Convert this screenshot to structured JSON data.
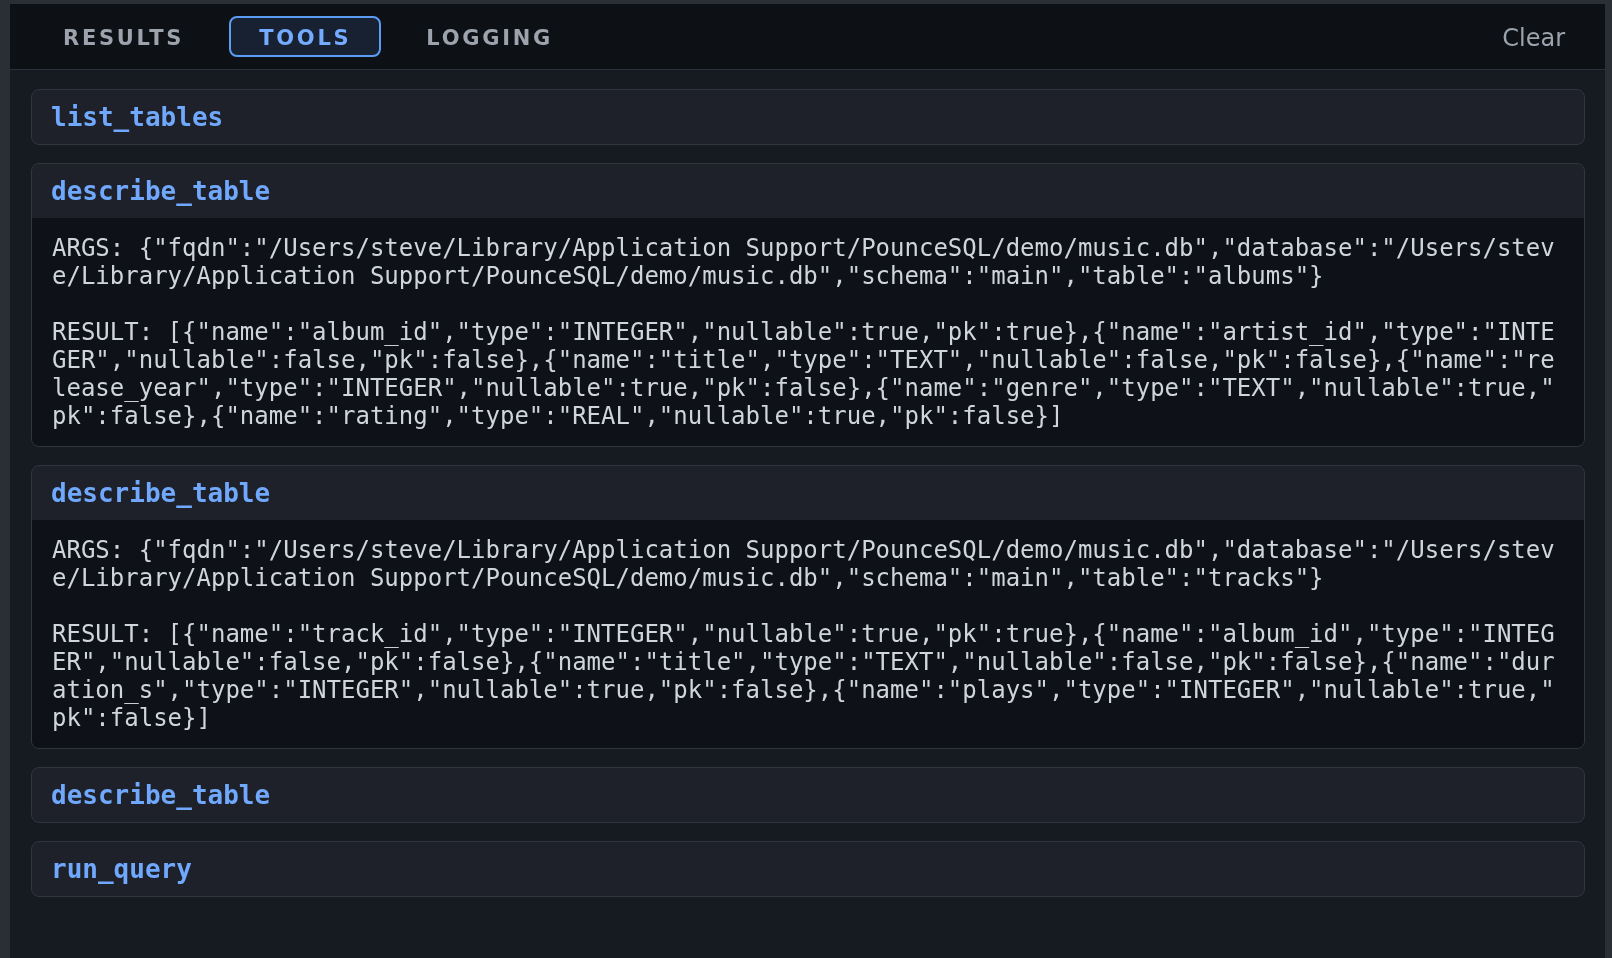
{
  "tabs": [
    {
      "label": "RESULTS",
      "selected": false
    },
    {
      "label": "TOOLS",
      "selected": true
    },
    {
      "label": "LOGGING",
      "selected": false
    }
  ],
  "clear_button": "Clear",
  "tool_calls": [
    {
      "name": "list_tables",
      "expanded": false
    },
    {
      "name": "describe_table",
      "expanded": true,
      "args": "ARGS: {\"fqdn\":\"/Users/steve/Library/Application Support/PounceSQL/demo/music.db\",\"database\":\"/Users/steve/Library/Application Support/PounceSQL/demo/music.db\",\"schema\":\"main\",\"table\":\"albums\"}",
      "result": "RESULT: [{\"name\":\"album_id\",\"type\":\"INTEGER\",\"nullable\":true,\"pk\":true},{\"name\":\"artist_id\",\"type\":\"INTEGER\",\"nullable\":false,\"pk\":false},{\"name\":\"title\",\"type\":\"TEXT\",\"nullable\":false,\"pk\":false},{\"name\":\"release_year\",\"type\":\"INTEGER\",\"nullable\":true,\"pk\":false},{\"name\":\"genre\",\"type\":\"TEXT\",\"nullable\":true,\"pk\":false},{\"name\":\"rating\",\"type\":\"REAL\",\"nullable\":true,\"pk\":false}]"
    },
    {
      "name": "describe_table",
      "expanded": true,
      "args": "ARGS: {\"fqdn\":\"/Users/steve/Library/Application Support/PounceSQL/demo/music.db\",\"database\":\"/Users/steve/Library/Application Support/PounceSQL/demo/music.db\",\"schema\":\"main\",\"table\":\"tracks\"}",
      "result": "RESULT: [{\"name\":\"track_id\",\"type\":\"INTEGER\",\"nullable\":true,\"pk\":true},{\"name\":\"album_id\",\"type\":\"INTEGER\",\"nullable\":false,\"pk\":false},{\"name\":\"title\",\"type\":\"TEXT\",\"nullable\":false,\"pk\":false},{\"name\":\"duration_s\",\"type\":\"INTEGER\",\"nullable\":true,\"pk\":false},{\"name\":\"plays\",\"type\":\"INTEGER\",\"nullable\":true,\"pk\":false}]"
    },
    {
      "name": "describe_table",
      "expanded": false
    },
    {
      "name": "run_query",
      "expanded": false
    }
  ]
}
